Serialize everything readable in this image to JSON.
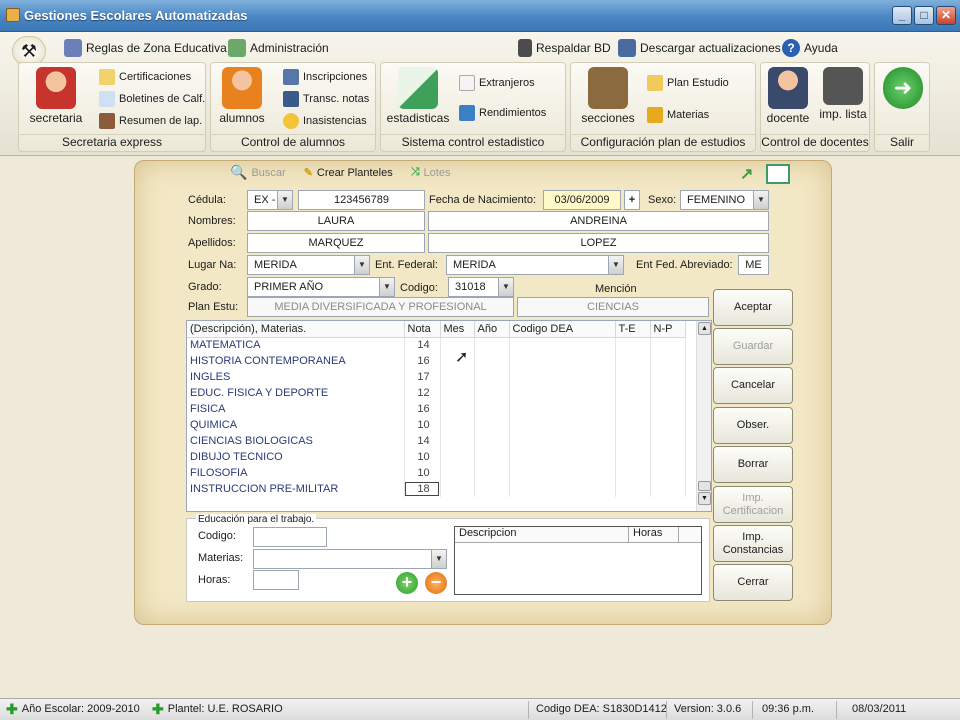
{
  "window": {
    "title": "Gestiones Escolares Automatizadas",
    "buttons": [
      "_",
      "□",
      "✕"
    ]
  },
  "quick": {
    "reglas": "Reglas de Zona Educativa",
    "admin": "Administración",
    "respaldar": "Respaldar BD",
    "descargar": "Descargar actualizaciones",
    "ayuda": "Ayuda"
  },
  "groups": {
    "secretaria": {
      "label": "Secretaria express",
      "big": "secretaria",
      "items": [
        "Certificaciones",
        "Boletines de Calf.",
        "Resumen de lap."
      ]
    },
    "alumnos": {
      "label": "Control de alumnos",
      "big": "alumnos",
      "items": [
        "Inscripciones",
        "Transc. notas",
        "Inasistencias"
      ]
    },
    "estadistico": {
      "label": "Sistema control estadistico",
      "big": "estadisticas",
      "items": [
        "Extranjeros",
        "Rendimientos"
      ]
    },
    "plan": {
      "label": "Configuración plan de estudios",
      "big": "secciones",
      "items": [
        "Plan Estudio",
        "Materias"
      ]
    },
    "docentes": {
      "label": "Control de docentes",
      "items": [
        "docente",
        "imp. lista"
      ]
    },
    "salir": {
      "label": "Salir"
    }
  },
  "toolbar": {
    "buscar": "Buscar",
    "crear": "Crear Planteles",
    "lotes": "Lotes"
  },
  "form": {
    "cedula_label": "Cédula:",
    "cedula_tipo": "EX -",
    "cedula": "123456789",
    "fecha_label": "Fecha de Nacimiento:",
    "fecha": "03/06/2009",
    "fecha_btn": "+",
    "sexo_label": "Sexo:",
    "sexo": "FEMENINO",
    "nombres_label": "Nombres:",
    "nombre1": "LAURA",
    "nombre2": "ANDREINA",
    "apellidos_label": "Apellidos:",
    "apellido1": "MARQUEZ",
    "apellido2": "LOPEZ",
    "lugar_label": "Lugar Na:",
    "lugar": "MERIDA",
    "entfed_label": "Ent. Federal:",
    "entfed": "MERIDA",
    "abrev_label": "Ent Fed. Abreviado:",
    "abrev": "ME",
    "grado_label": "Grado:",
    "grado": "PRIMER AÑO",
    "codigo_label": "Codigo:",
    "codigo": "31018",
    "mencion_label": "Mención",
    "plan_label": "Plan Estu:",
    "plan": "MEDIA DIVERSIFICADA Y PROFESIONAL",
    "mencion": "CIENCIAS"
  },
  "grid": {
    "headers": [
      "(Descripción), Materias.",
      "Nota",
      "Mes",
      "Año",
      "Codigo DEA",
      "T-E",
      "N-P"
    ],
    "rows": [
      {
        "materia": "MATEMATICA",
        "nota": "14"
      },
      {
        "materia": "HISTORIA CONTEMPORANEA",
        "nota": "16"
      },
      {
        "materia": "INGLES",
        "nota": "17"
      },
      {
        "materia": "EDUC. FISICA Y DEPORTE",
        "nota": "12"
      },
      {
        "materia": "FISICA",
        "nota": "16"
      },
      {
        "materia": "QUIMICA",
        "nota": "10"
      },
      {
        "materia": "CIENCIAS BIOLOGICAS",
        "nota": "14"
      },
      {
        "materia": "DIBUJO TECNICO",
        "nota": "10"
      },
      {
        "materia": "FILOSOFIA",
        "nota": "10"
      },
      {
        "materia": "INSTRUCCION PRE-MILITAR",
        "nota": "18"
      }
    ]
  },
  "buttons": {
    "aceptar": "Aceptar",
    "guardar": "Guardar",
    "cancelar": "Cancelar",
    "obser": "Obser.",
    "borrar": "Borrar",
    "impcert1": "Imp.",
    "impcert2": "Certificacion",
    "impcons1": "Imp.",
    "impcons2": "Constancias",
    "cerrar": "Cerrar"
  },
  "trabajo": {
    "legend": "Educación para el trabajo.",
    "codigo": "Codigo:",
    "materias": "Materias:",
    "horas": "Horas:",
    "col_desc": "Descripcion",
    "col_horas": "Horas"
  },
  "status": {
    "anio": "Año Escolar: 2009-2010",
    "plantel": "Plantel: U.E. ROSARIO",
    "dea": "Codigo DEA: S1830D1412",
    "version": "Version: 3.0.6",
    "hora": "09:36 p.m.",
    "fecha": "08/03/2011"
  }
}
